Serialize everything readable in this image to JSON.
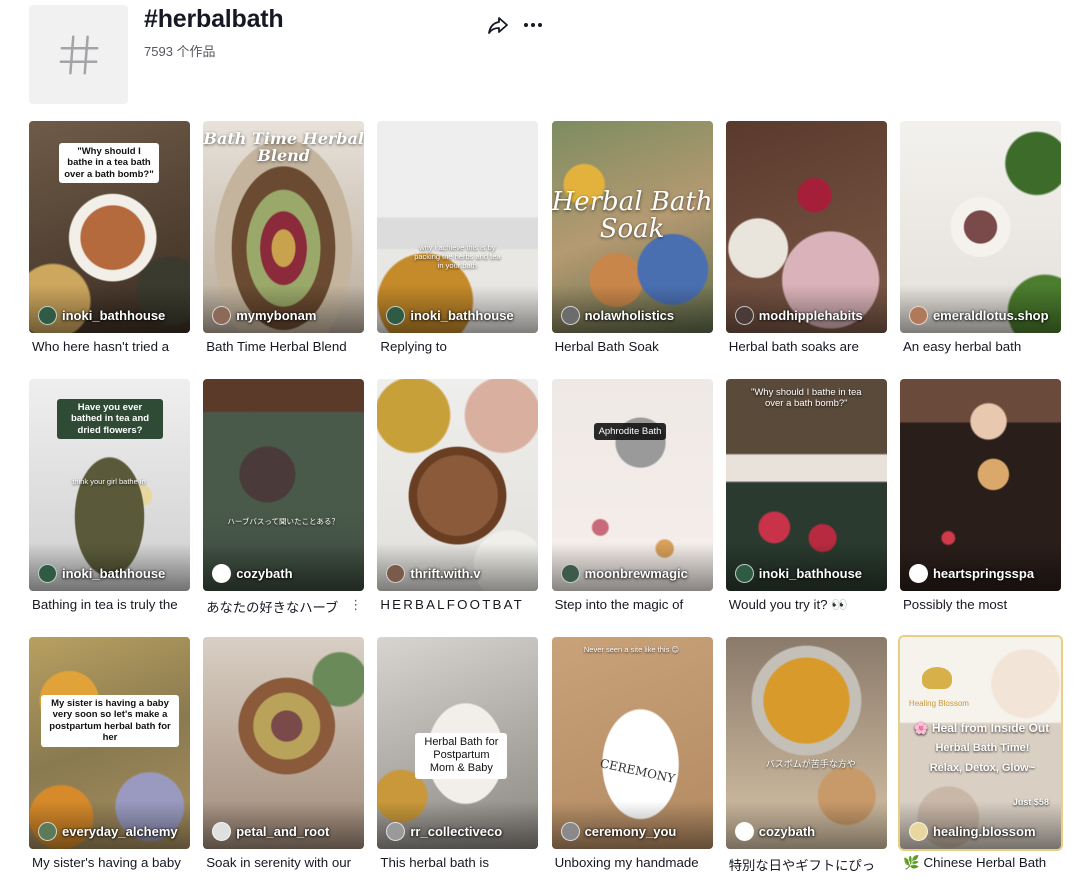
{
  "header": {
    "title": "#herbalbath",
    "count": "7593 个作品"
  },
  "colors": {
    "text": "#161823",
    "subtext": "#55575f",
    "placeholder": "#f1f1f2"
  },
  "icons": {
    "tag": "hashtag-icon",
    "share": "share-arrow-icon",
    "more": "more-dots-icon"
  },
  "videos": [
    {
      "author": "inoki_bathhouse",
      "desc": "Who here hasn't tried a",
      "overlay": "\"Why should I bathe in a tea bath over a bath bomb?\""
    },
    {
      "author": "mymybonam",
      "desc": "Bath Time Herbal Blend",
      "overlay": "Bath Time Herbal Blend"
    },
    {
      "author": "inoki_bathhouse",
      "desc": "Replying to",
      "overlay": "why i achieve this is by packing the herbs and tea in your bath"
    },
    {
      "author": "nolawholistics",
      "desc": "Herbal Bath Soak",
      "overlay": "Herbal Bath Soak"
    },
    {
      "author": "modhipplehabits",
      "desc": "Herbal bath soaks are",
      "overlay": ""
    },
    {
      "author": "emeraldlotus.shop",
      "desc": "An easy herbal bath",
      "overlay": ""
    },
    {
      "author": "inoki_bathhouse",
      "desc": "Bathing in tea is truly the",
      "overlay": "Have you ever bathed in tea and dried flowers?",
      "overlay2": "think your girl bathe in"
    },
    {
      "author": "cozybath",
      "desc": "あなたの好きなハーブ",
      "overlay": "ハーブバスって聞いたことある？"
    },
    {
      "author": "thrift.with.v",
      "desc": "HERBALFOOTBAT",
      "overlay": ""
    },
    {
      "author": "moonbrewmagic",
      "desc": "Step into the magic of",
      "overlay": "Aphrodite Bath"
    },
    {
      "author": "inoki_bathhouse",
      "desc": "Would you try it? 👀",
      "overlay": "\"Why should I bathe in tea over a bath bomb?\""
    },
    {
      "author": "heartspringsspa",
      "desc": "Possibly the most",
      "overlay": ""
    },
    {
      "author": "everyday_alchemy",
      "desc": "My sister's having a baby",
      "overlay": "My sister is having a baby very soon so let's make a postpartum herbal bath for her"
    },
    {
      "author": "petal_and_root",
      "desc": "Soak in serenity with our",
      "overlay": ""
    },
    {
      "author": "rr_collectiveco",
      "desc": "This herbal bath is",
      "overlay": "Herbal Bath for Postpartum Mom & Baby"
    },
    {
      "author": "ceremony_you",
      "desc": "Unboxing my handmade",
      "overlay": "Never seen a site like this 😊",
      "overlay2": "CEREMONY"
    },
    {
      "author": "cozybath",
      "desc": "特別な日やギフトにぴっ",
      "overlay": "バスボムが苦手な方や"
    },
    {
      "author": "healing.blossom",
      "desc": "Chinese Herbal Bath",
      "overlay": "Healing Blossom",
      "overlay2": "🌸 Heal from Inside Out",
      "overlay3": "Herbal Bath Time!",
      "overlay4": "Relax, Detox, Glow~",
      "overlay5": "Just $58"
    }
  ]
}
